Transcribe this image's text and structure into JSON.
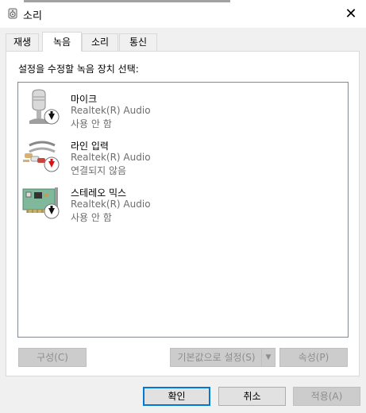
{
  "window": {
    "title": "소리",
    "close_glyph": "✕"
  },
  "tabs": [
    {
      "label": "재생",
      "active": false
    },
    {
      "label": "녹음",
      "active": true
    },
    {
      "label": "소리",
      "active": false
    },
    {
      "label": "통신",
      "active": false
    }
  ],
  "recording": {
    "instruction": "설정을 수정할 녹음 장치 선택:",
    "devices": [
      {
        "name": "마이크",
        "driver": "Realtek(R) Audio",
        "status": "사용 안 함",
        "icon": "microphone-icon",
        "badge": "disabled-down-arrow-icon"
      },
      {
        "name": "라인 입력",
        "driver": "Realtek(R) Audio",
        "status": "연결되지 않음",
        "icon": "line-in-cable-icon",
        "badge": "unplugged-red-arrow-icon"
      },
      {
        "name": "스테레오 믹스",
        "driver": "Realtek(R) Audio",
        "status": "사용 안 함",
        "icon": "sound-card-icon",
        "badge": "disabled-down-arrow-icon"
      }
    ],
    "buttons": {
      "configure": "구성(C)",
      "set_default": "기본값으로 설정(S)",
      "properties": "속성(P)"
    }
  },
  "footer": {
    "ok": "확인",
    "cancel": "취소",
    "apply": "적용(A)"
  },
  "colors": {
    "accent": "#0078d7",
    "disabled_text": "#8e8e8e",
    "secondary_text": "#6d6d6d"
  }
}
